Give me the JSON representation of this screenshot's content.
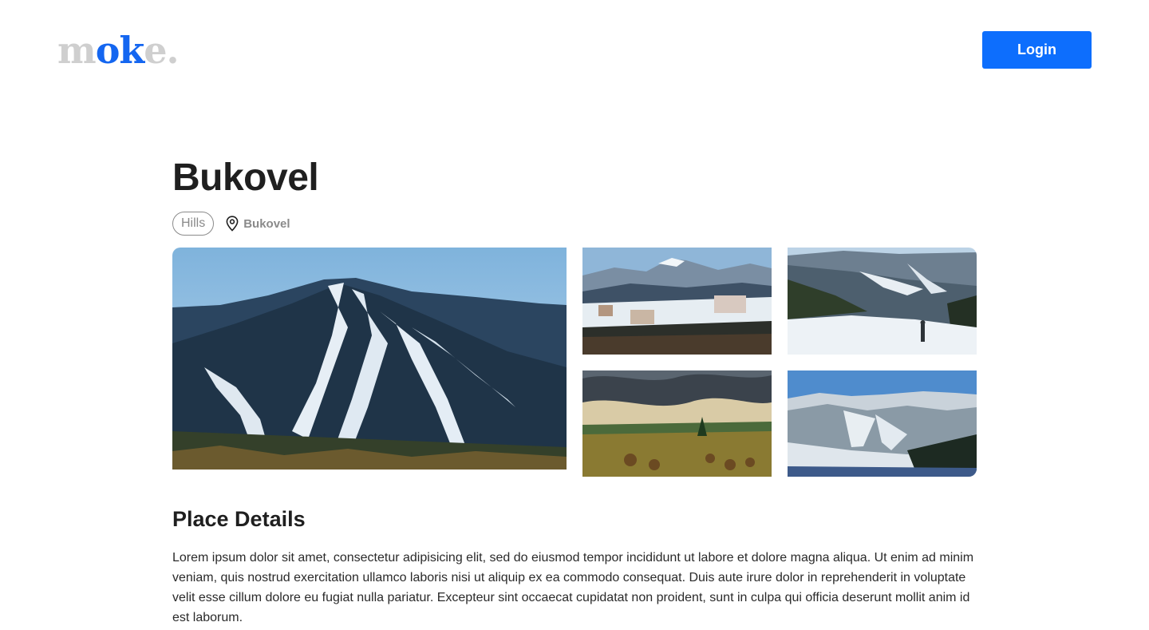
{
  "header": {
    "logo": {
      "part1": "m",
      "part2": "ok",
      "part3": "e",
      "part4": "."
    },
    "login_label": "Login"
  },
  "place": {
    "title": "Bukovel",
    "tag": "Hills",
    "location_icon": "map-pin-icon",
    "location": "Bukovel"
  },
  "gallery": {
    "images": [
      {
        "name": "ski-slopes-forest-photo"
      },
      {
        "name": "resort-town-mountains-photo"
      },
      {
        "name": "skier-on-slope-photo"
      },
      {
        "name": "hay-field-storm-clouds-photo"
      },
      {
        "name": "snowy-mountain-range-photo"
      }
    ]
  },
  "details": {
    "heading": "Place Details",
    "text": "Lorem ipsum dolor sit amet, consectetur adipisicing elit, sed do eiusmod tempor incididunt ut labore et dolore magna aliqua. Ut enim ad minim veniam, quis nostrud exercitation ullamco laboris nisi ut aliquip ex ea commodo consequat. Duis aute irure dolor in reprehenderit in voluptate velit esse cillum dolore eu fugiat nulla pariatur. Excepteur sint occaecat cupidatat non proident, sunt in culpa qui officia deserunt mollit anim id est laborum."
  },
  "colors": {
    "accent": "#0d6efd",
    "logo_blue": "#1466f0",
    "logo_grey": "#cfcfcf",
    "muted": "#8a8a8a"
  }
}
